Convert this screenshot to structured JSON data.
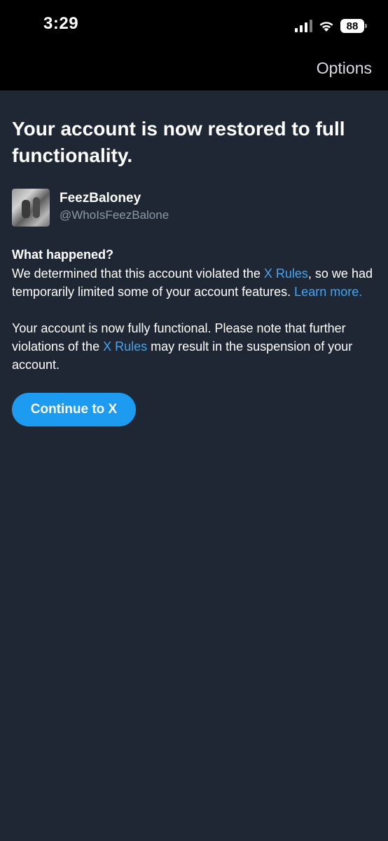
{
  "status_bar": {
    "time": "3:29",
    "battery_level": "88"
  },
  "header": {
    "options_label": "Options"
  },
  "title": "Your account is now restored to full functionality.",
  "account": {
    "display_name": "FeezBaloney",
    "handle": "@WhoIsFeezBalone"
  },
  "what_happened": {
    "heading": "What happened?",
    "p1_before": "We determined that this account violated the ",
    "p1_link": "X Rules",
    "p1_after": ", so we had temporarily limited some of your account features. ",
    "p1_learn_more": "Learn more.",
    "p2_before": "Your account is now fully functional. Please note that further violations of the ",
    "p2_link": "X Rules",
    "p2_after": " may result in the suspension of your account."
  },
  "continue_button": {
    "label": "Continue to X"
  },
  "colors": {
    "background": "#1e2733",
    "accent": "#1d9bf0",
    "link": "#4aa3ec",
    "secondary_text": "#8b98a5"
  },
  "icons": [
    "signal-icon",
    "wifi-icon",
    "battery-icon"
  ]
}
